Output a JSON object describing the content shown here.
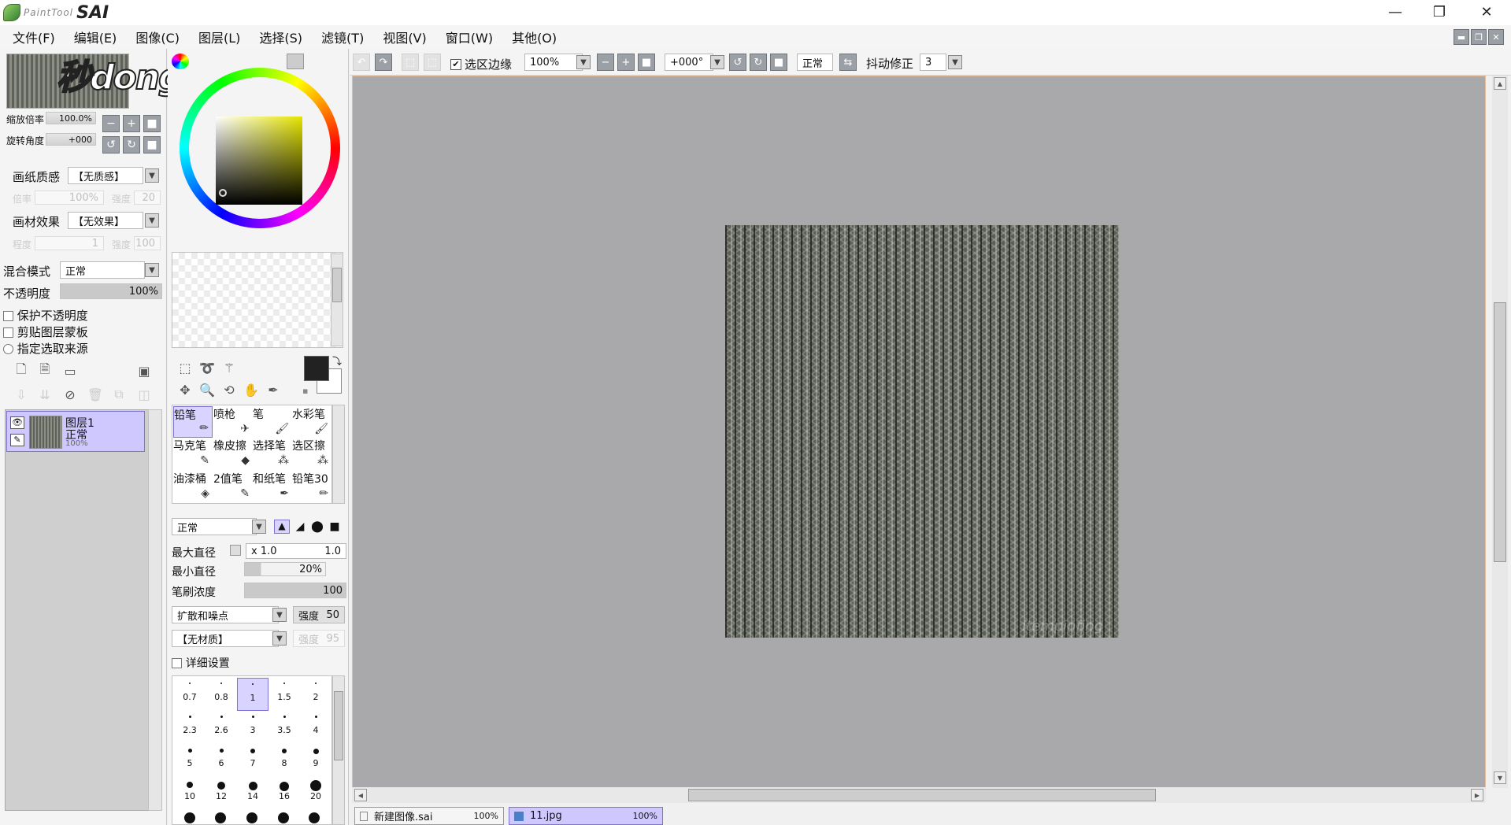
{
  "app": {
    "logo_small": "PaintTool",
    "logo_big": "SAI",
    "window_controls": [
      "—",
      "❐",
      "✕"
    ]
  },
  "menu": [
    "文件(F)",
    "编辑(E)",
    "图像(C)",
    "图层(L)",
    "选择(S)",
    "滤镜(T)",
    "视图(V)",
    "窗口(W)",
    "其他(O)"
  ],
  "watermark": "秒dong视频",
  "navigator": {
    "zoom_label": "缩放倍率",
    "zoom_value": "100.0%",
    "rotate_label": "旋转角度",
    "rotate_value": "+000"
  },
  "paper": {
    "texture_label": "画纸质感",
    "texture_value": "【无质感】",
    "scale_label": "倍率",
    "scale_value": "100%",
    "strength_label": "强度",
    "strength_value": "20",
    "effect_label": "画材效果",
    "effect_value": "【无效果】",
    "degree_label": "程度",
    "degree_value": "1",
    "strength2_label": "强度",
    "strength2_value": "100"
  },
  "layer_props": {
    "blend_label": "混合模式",
    "blend_value": "正常",
    "opacity_label": "不透明度",
    "opacity_value": "100%",
    "opacity_fraction": 1.0,
    "protect_opacity": "保护不透明度",
    "clip_mask": "剪贴图层蒙板",
    "selection_source": "指定选取来源"
  },
  "layers": [
    {
      "name": "图层1",
      "mode": "正常",
      "opacity": "100%"
    }
  ],
  "tools": {
    "row1": [
      "铅笔",
      "喷枪",
      "笔",
      "水彩笔"
    ],
    "row2": [
      "马克笔",
      "橡皮擦",
      "选择笔",
      "选区擦"
    ],
    "row3": [
      "油漆桶",
      "2值笔",
      "和纸笔",
      "铅笔30"
    ]
  },
  "brush": {
    "mode_value": "正常",
    "max_size_label": "最大直径",
    "max_size_mult": "x 1.0",
    "max_size_value": "1.0",
    "min_size_label": "最小直径",
    "min_size_value": "20%",
    "min_size_fraction": 0.2,
    "density_label": "笔刷浓度",
    "density_value": "100",
    "density_fraction": 1.0,
    "noise_value": "扩散和噪点",
    "noise_strength_label": "强度",
    "noise_strength_value": "50",
    "material_value": "【无材质】",
    "material_strength_label": "强度",
    "material_strength_value": "95",
    "detail_label": "详细设置"
  },
  "brush_sizes": [
    "0.7",
    "0.8",
    "1",
    "1.5",
    "2",
    "2.3",
    "2.6",
    "3",
    "3.5",
    "4",
    "5",
    "6",
    "7",
    "8",
    "9",
    "10",
    "12",
    "14",
    "16",
    "20"
  ],
  "toolbar": {
    "selection_edge": "选区边缘",
    "zoom_value": "100%",
    "angle_value": "+000°",
    "blend_value": "正常",
    "stabilizer_label": "抖动修正",
    "stabilizer_value": "3"
  },
  "tabs": [
    {
      "name": "新建图像.sai",
      "zoom": "100%"
    },
    {
      "name": "11.jpg",
      "zoom": "100%"
    }
  ],
  "canvas_text": "itempinfing"
}
